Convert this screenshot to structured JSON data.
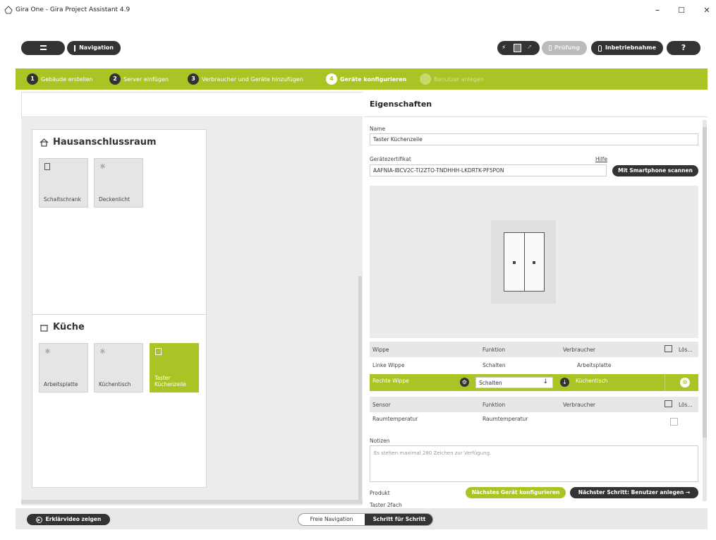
{
  "window": {
    "title": "Gira One - Gira Project Assistant 4.9",
    "minimize": "–",
    "maximize": "☐",
    "close": "✕"
  },
  "toolbar": {
    "menu_icon": "hamburger-menu-icon",
    "navigation_label": "Navigation",
    "pruefung_label": "Prüfung",
    "inbetriebnahme_label": "Inbetriebnahme",
    "help_label": "?"
  },
  "steps": [
    {
      "num": "1",
      "label": "Gebäude erstellen"
    },
    {
      "num": "2",
      "label": "Server einfügen"
    },
    {
      "num": "3",
      "label": "Verbraucher und Geräte hinzufügen"
    },
    {
      "num": "4",
      "label": "Geräte konfigurieren"
    },
    {
      "num": "5",
      "label": "Benutzer anlegen"
    }
  ],
  "rooms": [
    {
      "name": "Hausanschlussraum",
      "tiles": [
        {
          "label": "Schaltschrank",
          "icon": "cabinet-icon"
        },
        {
          "label": "Deckenlicht",
          "icon": "light-icon"
        }
      ]
    },
    {
      "name": "Küche",
      "tiles": [
        {
          "label": "Arbeitsplatte",
          "icon": "light-icon"
        },
        {
          "label": "Küchentisch",
          "icon": "light-icon"
        },
        {
          "label": "Taster Küchenzeile",
          "icon": "switch-icon",
          "selected": true
        }
      ]
    }
  ],
  "properties": {
    "title": "Eigenschaften",
    "name_label": "Name",
    "name_value": "Taster Küchenzeile",
    "cert_label": "Gerätezertifikat",
    "help_link": "Hilfe",
    "cert_value": "AAFNIA-IBCV2C-TI2ZTO-TNDHHH-LKDRTK-PF5PON",
    "scan_button": "Mit Smartphone scannen",
    "wippe_table": {
      "headers": [
        "Wippe",
        "Funktion",
        "Verbraucher",
        "Lös..."
      ],
      "rows": [
        {
          "wippe": "Linke Wippe",
          "funktion": "Schalten",
          "verbraucher": "Arbeitsplatte"
        },
        {
          "wippe": "Rechte Wippe",
          "funktion": "Schalten",
          "verbraucher": "Küchentisch",
          "selected": true
        }
      ]
    },
    "sensor_table": {
      "headers": [
        "Sensor",
        "Funktion",
        "Verbraucher",
        "Lös..."
      ],
      "rows": [
        {
          "sensor": "Raumtemperatur",
          "funktion": "Raumtemperatur",
          "verbraucher": ""
        }
      ]
    },
    "notes_label": "Notizen",
    "notes_placeholder": "Es stehen maximal 280 Zeichen zur Verfügung.",
    "product_label": "Produkt",
    "product_value": "Taster 2fach",
    "next_device_button": "Nächstes Gerät konfigurieren",
    "next_step_button": "Nächster Schritt: Benutzer anlegen →"
  },
  "bottom": {
    "video_button": "Erklärvideo zeigen",
    "mode_free": "Freie Navigation",
    "mode_step": "Schritt für Schritt"
  },
  "colors": {
    "accent": "#a8c525",
    "dark": "#333333"
  }
}
